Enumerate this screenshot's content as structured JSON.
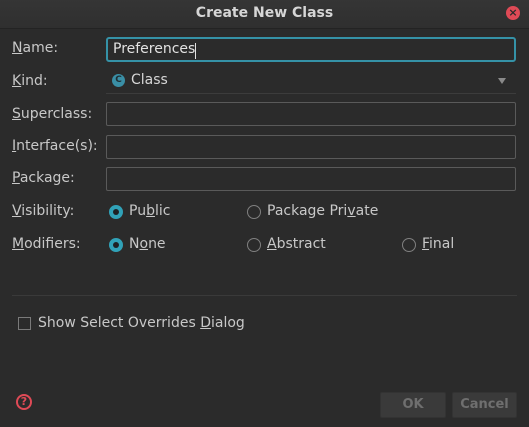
{
  "window": {
    "title": "Create New Class",
    "close_icon": "×"
  },
  "form": {
    "name": {
      "label": "Name:",
      "mnemonic": "N",
      "rest": "ame:",
      "value": "Preferences"
    },
    "kind": {
      "mnemonic": "K",
      "rest": "ind:",
      "icon": "C",
      "selected": "Class"
    },
    "superclass": {
      "mnemonic": "S",
      "rest": "uperclass:",
      "value": ""
    },
    "interfaces": {
      "mnemonic": "I",
      "rest": "nterface(s):",
      "value": ""
    },
    "package": {
      "mnemonic": "P",
      "rest": "ackage:",
      "value": ""
    },
    "visibility": {
      "mnemonic": "V",
      "rest": "isibility:",
      "options": [
        {
          "pre": "Pu",
          "mn": "b",
          "post": "lic",
          "checked": true
        },
        {
          "pre": "Package Pri",
          "mn": "v",
          "post": "ate",
          "checked": false
        }
      ]
    },
    "modifiers": {
      "mnemonic": "M",
      "rest": "odifiers:",
      "options": [
        {
          "pre": "N",
          "mn": "o",
          "post": "ne",
          "checked": true
        },
        {
          "pre": "",
          "mn": "A",
          "post": "bstract",
          "checked": false
        },
        {
          "pre": "",
          "mn": "F",
          "post": "inal",
          "checked": false
        }
      ]
    },
    "show_overrides": {
      "pre": "Show Select Overrides ",
      "mn": "D",
      "post": "ialog",
      "checked": false
    }
  },
  "buttons": {
    "ok": "OK",
    "cancel": "Cancel"
  },
  "help_icon": "?",
  "colors": {
    "accent": "#31a2b8",
    "close": "#df4a56",
    "background": "#2b2b2b"
  }
}
